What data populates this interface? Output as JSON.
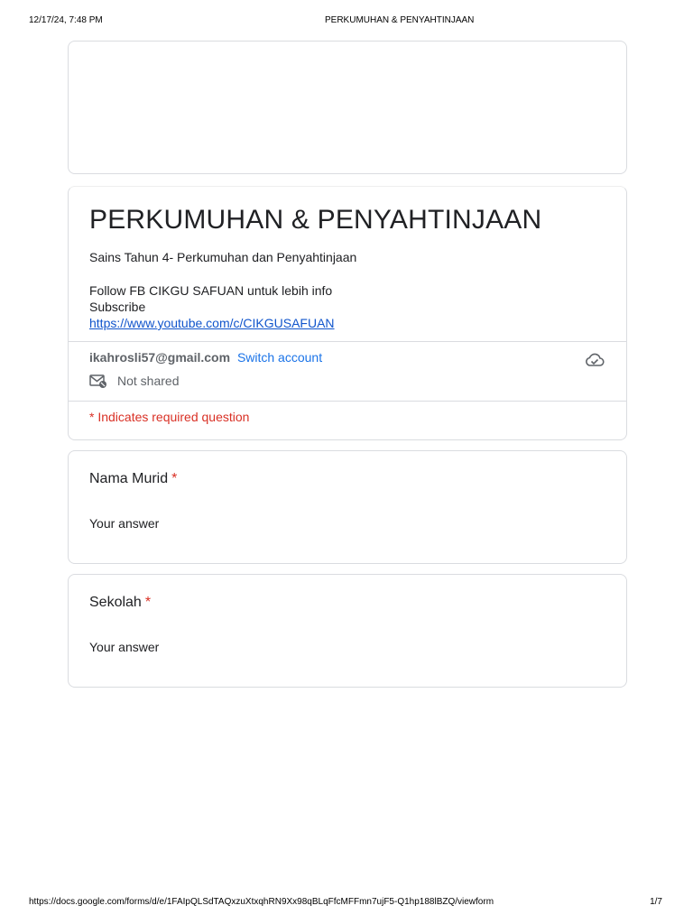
{
  "print_header": {
    "datetime": "12/17/24, 7:48 PM",
    "title": "PERKUMUHAN & PENYAHTINJAAN"
  },
  "form": {
    "title": "PERKUMUHAN & PENYAHTINJAAN",
    "description": {
      "line1": "Sains Tahun 4- Perkumuhan dan Penyahtinjaan",
      "line2": "Follow FB CIKGU SAFUAN untuk lebih info",
      "line3": "Subscribe",
      "link": "https://www.youtube.com/c/CIKGUSAFUAN"
    },
    "account": {
      "email": "ikahrosli57@gmail.com",
      "switch_label": "Switch account",
      "not_shared_label": "Not shared"
    },
    "required_note": "* Indicates required question",
    "questions": [
      {
        "label": "Nama Murid",
        "required_mark": "*",
        "answer_placeholder": "Your answer"
      },
      {
        "label": "Sekolah",
        "required_mark": "*",
        "answer_placeholder": "Your answer"
      }
    ]
  },
  "print_footer": {
    "url": "https://docs.google.com/forms/d/e/1FAIpQLSdTAQxzuXtxqhRN9Xx98qBLqFfcMFFmn7ujF5-Q1hp188lBZQ/viewform",
    "page": "1/7"
  },
  "icons": {
    "mail": "mail-not-shared-icon",
    "cloud": "cloud-saved-icon"
  },
  "colors": {
    "required": "#d93025",
    "link": "#1a73e8",
    "border": "#dadce0"
  }
}
